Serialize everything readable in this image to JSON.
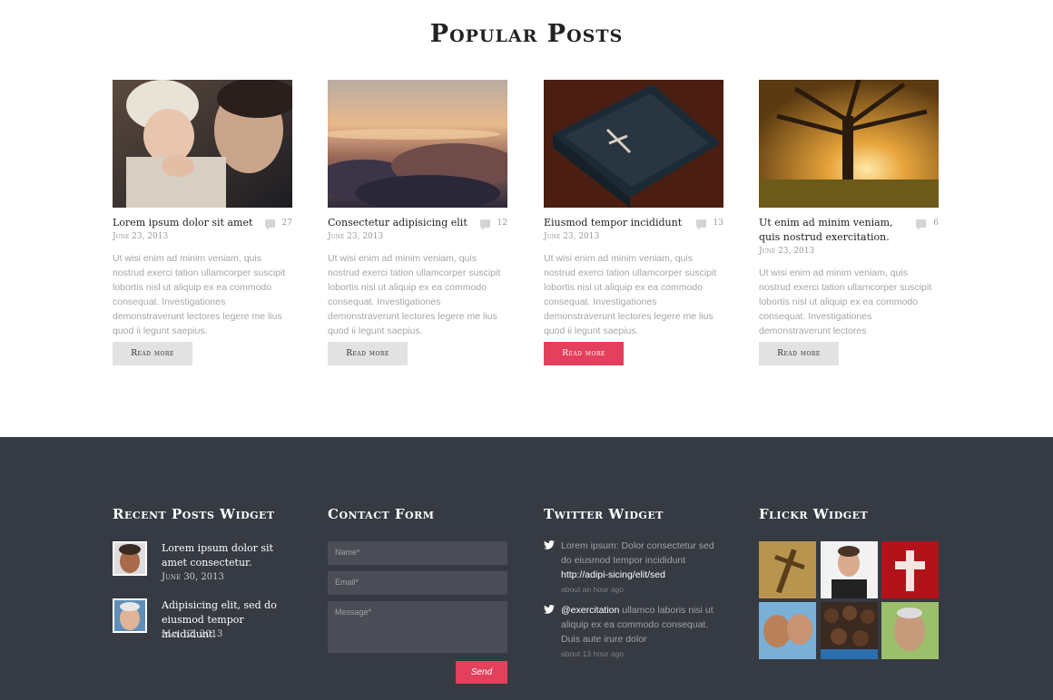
{
  "popular": {
    "title": "Popular Posts",
    "read_more": "Read more",
    "posts": [
      {
        "title": "Lorem ipsum dolor sit amet",
        "date": "June 23, 2013",
        "comments": "27",
        "excerpt": "Ut wisi enim ad minim veniam, quis nostrud exerci tation ullamcorper suscipit lobortis nisl ut aliquip ex ea commodo consequat. Investigationes demonstraverunt lectores legere me lius quod ii legunt saepius."
      },
      {
        "title": "Consectetur adipisicing elit",
        "date": "June 23, 2013",
        "comments": "12",
        "excerpt": "Ut wisi enim ad minim veniam, quis nostrud exerci tation ullamcorper suscipit lobortis nisl ut aliquip ex ea commodo consequat. Investigationes demonstraverunt lectores legere me lius quod ii legunt saepius."
      },
      {
        "title": "Eiusmod tempor incididunt",
        "date": "June 23, 2013",
        "comments": "13",
        "excerpt": "Ut wisi enim ad minim veniam, quis nostrud exerci tation ullamcorper suscipit lobortis nisl ut aliquip ex ea commodo consequat. Investigationes demonstraverunt lectores legere me lius quod ii legunt saepius."
      },
      {
        "title": "Ut enim ad minim veniam, quis nostrud exercitation.",
        "date": "June 23, 2013",
        "comments": "6",
        "excerpt": "Ut wisi enim ad minim veniam, quis nostrud exerci tation ullamcorper suscipit lobortis nisl ut aliquip ex ea commodo consequat. Investigationes demonstraverunt lectores"
      }
    ]
  },
  "footer": {
    "recent_posts": {
      "title": "Recent Posts Widget",
      "items": [
        {
          "title": "Lorem ipsum dolor sit amet consectetur.",
          "date": "June 30, 2013"
        },
        {
          "title": "Adipisicing elit, sed do eiusmod tempor incididunt.",
          "date": "May 12, 2013"
        }
      ]
    },
    "contact": {
      "title": "Contact Form",
      "name_placeholder": "Name*",
      "email_placeholder": "Email*",
      "message_placeholder": "Message*",
      "send_label": "Send"
    },
    "twitter": {
      "title": "Twitter Widget",
      "tweets": [
        {
          "text": "Lorem ipsum: Dolor consectetur sed do eiusmod tempor incididunt ",
          "link": "http://adipi-sicing/elit/sed",
          "time": "about an hour ago"
        },
        {
          "mention": "@exercitation",
          "text": " ullamco laboris nisi ut aliquip ex ea commodo consequat. Duis aute irure dolor",
          "time": "about 13 hour ago"
        }
      ]
    },
    "flickr": {
      "title": "Flickr Widget"
    }
  },
  "colors": {
    "accent": "#e2405c",
    "footer_bg": "#363a42",
    "button_bg": "#e2e2e2"
  }
}
